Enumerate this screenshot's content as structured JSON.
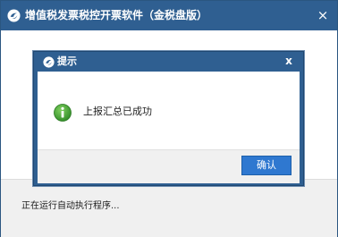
{
  "main_window": {
    "title": "增值税发票税控开票软件（金税盘版）",
    "close_glyph": "×",
    "status_text": "正在运行自动执行程序..."
  },
  "dialog": {
    "title": "提示",
    "close_glyph": "x",
    "message": "上报汇总已成功",
    "confirm_label": "确认",
    "icon": "info-icon"
  },
  "colors": {
    "titlebar": "#2f5f91",
    "confirm_button": "#2f78d0",
    "info_icon": "#3c9a2f"
  }
}
